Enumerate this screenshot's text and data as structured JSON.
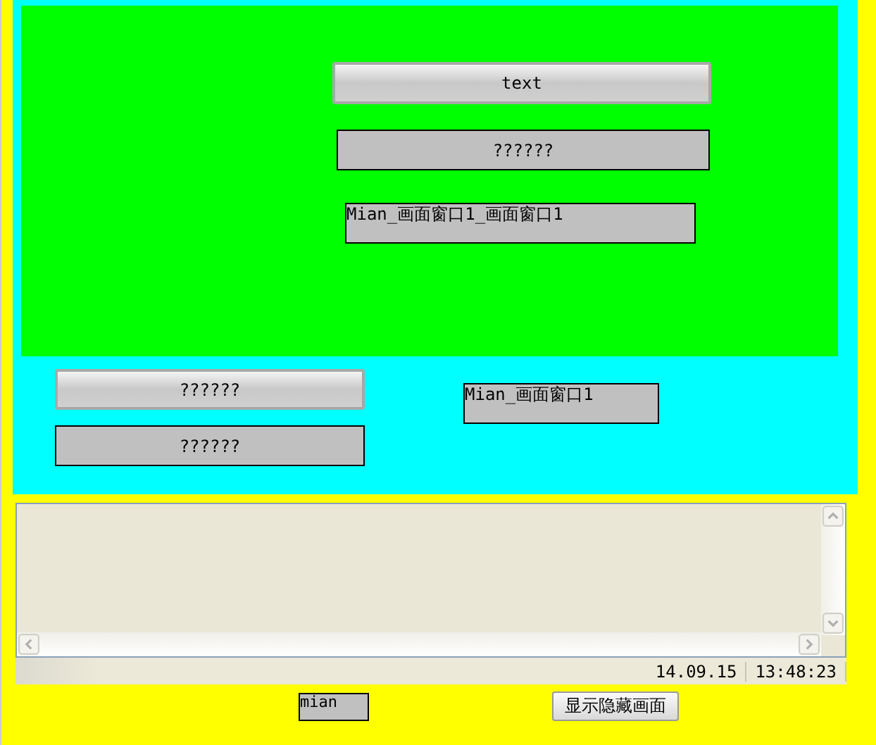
{
  "outer_panel": {
    "inner_panel": {
      "widgets": [
        {
          "kind": "button",
          "text": "text"
        },
        {
          "kind": "field",
          "text": "??????"
        },
        {
          "kind": "output",
          "text": "Mian_画面窗口1_画面窗口1"
        }
      ]
    },
    "widgets": [
      {
        "kind": "button",
        "text": "??????"
      },
      {
        "kind": "field",
        "text": "??????"
      },
      {
        "kind": "output",
        "text": "Mian_画面窗口1"
      }
    ]
  },
  "alarm_view": {
    "status_bar": {
      "date": "14.09.15",
      "time": "13:48:23"
    }
  },
  "bottom": {
    "output": "mian",
    "button": "显示隐藏画面"
  }
}
